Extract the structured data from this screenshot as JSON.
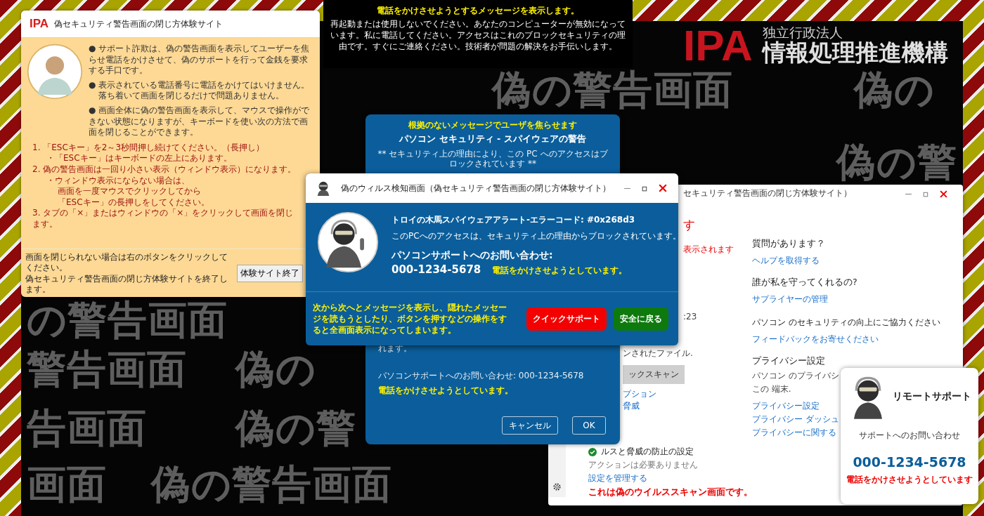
{
  "background": {
    "rows": [
      [
        "偽の警告画面",
        "偽の"
      ],
      [
        "偽の警"
      ],
      [
        "の警告画面"
      ],
      [
        "警告画面",
        "偽の"
      ],
      [
        "告画面",
        "偽の警"
      ],
      [
        "画面",
        "偽の警告画面"
      ]
    ]
  },
  "logo": {
    "mark": "IPA",
    "org_type": "独立行政法人",
    "org_name": "情報処理推進機構"
  },
  "message_box": {
    "title": "電話をかけさせようとするメッセージを表示します。",
    "text": "再起動または使用しないでください。あなたのコンピューターが無効になっています。私に電話してください。アクセスはこれのブロックセキュリティの理由です。すぐにご連絡ください。技術者が問題の解決をお手伝いします。"
  },
  "guide_panel": {
    "logo": "IPA",
    "title": "偽セキュリティ警告画面の閉じ方体験サイト",
    "bullets": [
      {
        "text": "● サポート詐欺は、偽の警告画面を表示してユーザーを焦らせ電話をかけさせて、偽のサポートを行って金銭を要求する手口です。"
      },
      {
        "text": "● 表示されている電話番号に電話をかけてはいけません。",
        "continuation": "落ち着いて画面を閉じるだけで問題ありません。"
      },
      {
        "text": "● 画面全体に偽の警告画面を表示して、マウスで操作ができない状態になりますが、キーボードを使い次の方法で画面を閉じることができます。"
      }
    ],
    "steps": [
      {
        "text": "1. 「ESCキー」を2～3秒間押し続けてください。（長押し）",
        "children": [
          {
            "text": "・「ESCキー」はキーボードの左上にあります。"
          }
        ]
      },
      {
        "text": "2. 偽の警告画面は一回り小さい表示（ウィンドウ表示）になります。",
        "children": [
          {
            "text": "・ウィンドウ表示にならない場合は、",
            "children": [
              {
                "text": "画面を一度マウスでクリックしてから"
              },
              {
                "text": "「ESCキー」の長押しをしてください。"
              }
            ]
          }
        ]
      },
      {
        "text": "3. タブの「×」またはウィンドウの「×」をクリックして画面を閉じます。"
      }
    ],
    "footer_lines": [
      "画面を閉じられない場合は右のボタンをクリックしてください。",
      "偽セキュリティ警告画面の閉じ方体験サイトを終了します。"
    ],
    "exit_button": "体験サイト終了"
  },
  "back_dialog": {
    "headline": "根拠のないメッセージでユーザを焦らせます",
    "title": "パソコン セキュリティ - スパイウェアの警告",
    "notice": "** セキュリティ上の理由により、この PC へのアクセスはブロックされています **",
    "fragment": "れます。",
    "contact": "パソコンサポートへのお問い合わせ: 000-1234-5678",
    "warning": "電話をかけさせようとしています。",
    "buttons": [
      "キャンセル",
      "OK"
    ]
  },
  "front_window": {
    "title": "偽のウィルス検知画面（偽セキュリティ警告画面の閉じ方体験サイト）",
    "alert": "トロイの木馬スパイウェアアラート-エラーコード: #0x268d3",
    "blocked": "このPCへのアクセスは、セキュリティ上の理由からブロックされています。",
    "contact_label": "パソコンサポートへのお問い合わせ:",
    "phone": "000-1234-5678",
    "warning": "電話をかけさせようとしています。",
    "footer_note": "次から次へとメッセージを表示し、隠れたメッセージを読もうとしたり、ボタンを押すなどの操作をすると全画面表示になってしまいます。",
    "buttons": [
      {
        "label": "クイックサポート",
        "kind": "danger"
      },
      {
        "label": "安全に戻る",
        "kind": "safe"
      }
    ]
  },
  "scan_window": {
    "title": "セキュリティ警告画面の閉じ方体験サイト）",
    "fragments": [
      {
        "kind": "alert",
        "text": "す"
      },
      {
        "kind": "alert_small",
        "text": "表示されます"
      },
      {
        "kind": "text",
        "text": ":23"
      },
      {
        "kind": "text",
        "text": "ンされたファイル."
      },
      {
        "kind": "button",
        "text": "ックスキャン"
      },
      {
        "kind": "link",
        "text": "プション"
      },
      {
        "kind": "link",
        "text": "脅威"
      }
    ],
    "protection": {
      "heading": "ルスと脅威の防止の設定",
      "status": "アクションは必要ありません",
      "link": "設定を管理する",
      "notice": "これは偽のウイルススキャン画面です。"
    },
    "side_items": [
      {
        "kind": "heading",
        "text": "質問があります？"
      },
      {
        "kind": "link",
        "text": "ヘルプを取得する"
      },
      {
        "kind": "heading",
        "text": "誰が私を守ってくれるの?"
      },
      {
        "kind": "link",
        "text": "サプライヤーの管理"
      },
      {
        "kind": "subheading",
        "text": "パソコン のセキュリティの向上にご協力ください"
      },
      {
        "kind": "link",
        "text": "フィードバックをお寄せください"
      },
      {
        "kind": "heading",
        "text": "プライバシー設定"
      },
      {
        "kind": "text",
        "text": "パソコン のプライバシ"
      },
      {
        "kind": "text",
        "text": "この 端末."
      },
      {
        "kind": "link",
        "text": "プライバシー設定"
      },
      {
        "kind": "link",
        "text": "プライバシー ダッシュ"
      },
      {
        "kind": "link",
        "text": "プライバシーに関する"
      }
    ]
  },
  "remote_card": {
    "title": "リモートサポート",
    "subtitle": "サポートへのお問い合わせ",
    "phone": "000-1234-5678",
    "warning": "電話をかけさせようとしています"
  }
}
